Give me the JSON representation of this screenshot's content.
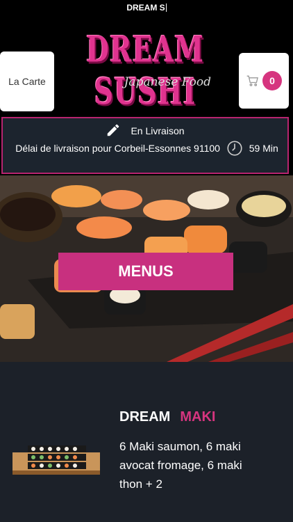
{
  "topbar": {
    "title": "DREAM S"
  },
  "header": {
    "carte_label": "La Carte",
    "logo_name": "DREAM SUSHI",
    "logo_tagline": "Japanese Food",
    "cart_count": "0"
  },
  "delivery": {
    "mode": "En Livraison",
    "delay_text": "Délai de livraison pour Corbeil-Essonnes 91100",
    "delay_value": "59",
    "delay_unit": "Min"
  },
  "hero": {
    "menus_label": "MENUS"
  },
  "product": {
    "title_main": "DREAM",
    "title_accent": "MAKI",
    "description": "6 Maki saumon, 6 maki avocat fromage, 6 maki thon + 2"
  },
  "colors": {
    "accent": "#d6357f",
    "panel": "#1c242e",
    "section": "#1c2129"
  },
  "icons": {
    "edit": "pencil-icon",
    "cart": "cart-icon",
    "timer": "clock-icon"
  }
}
